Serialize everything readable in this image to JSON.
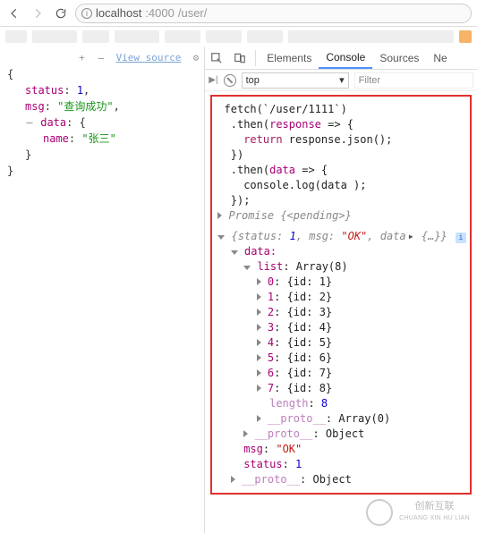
{
  "browser": {
    "url_prefix": "localhost",
    "url_port": ":4000",
    "url_path": "/user/"
  },
  "left_panel": {
    "viewsource_label": "View source",
    "json": {
      "status_key": "status",
      "status_val": "1",
      "msg_key": "msg",
      "msg_val": "\"查询成功\"",
      "data_key": "data",
      "name_key": "name",
      "name_val": "\"张三\""
    }
  },
  "devtools": {
    "tabs": {
      "elements": "Elements",
      "console": "Console",
      "sources": "Sources",
      "next": "Ne"
    },
    "context": "top",
    "filter_placeholder": "Filter"
  },
  "console_code": {
    "l1": "fetch(`/user/1111`)",
    "l2a": "  .then(",
    "l2b": "response",
    "l2c": " => {",
    "l3": "    return response.json();",
    "l4": "  })",
    "l5a": "  .then(",
    "l5b": "data",
    "l5c": " => {",
    "l6": "    console.log(data );",
    "l7": "  });"
  },
  "console_out": {
    "promise": "Promise {<pending>}",
    "summary_prefix": "{status: ",
    "summary_status": "1",
    "summary_msg_lbl": ", msg: ",
    "summary_msg": "\"OK\"",
    "summary_data_lbl": ", data",
    "summary_rest": " {…}}",
    "data_label": "data:",
    "list_label": "list",
    "list_type": "Array(8)",
    "items": [
      {
        "idx": "0",
        "body": "{id: 1}"
      },
      {
        "idx": "1",
        "body": "{id: 2}"
      },
      {
        "idx": "2",
        "body": "{id: 3}"
      },
      {
        "idx": "3",
        "body": "{id: 4}"
      },
      {
        "idx": "4",
        "body": "{id: 5}"
      },
      {
        "idx": "5",
        "body": "{id: 6}"
      },
      {
        "idx": "6",
        "body": "{id: 7}"
      },
      {
        "idx": "7",
        "body": "{id: 8}"
      }
    ],
    "length_key": "length",
    "length_val": "8",
    "proto": "__proto__",
    "arr0": "Array(0)",
    "object": "Object",
    "msg_key": "msg",
    "msg_val": "\"OK\"",
    "status_key": "status",
    "status_val": "1"
  },
  "watermark": {
    "line1": "创新互联",
    "line2": "CHUANG XIN HU LIAN"
  }
}
